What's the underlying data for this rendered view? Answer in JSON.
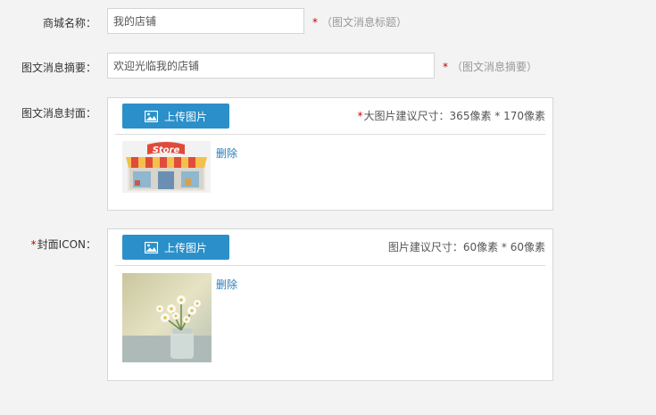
{
  "form": {
    "shop_name": {
      "label": "商城名称：",
      "value": "我的店铺",
      "hint": "（图文消息标题）"
    },
    "summary": {
      "label": "图文消息摘要：",
      "value": "欢迎光临我的店铺",
      "hint": "（图文消息摘要）"
    },
    "cover": {
      "label": "图文消息封面：",
      "upload_label": "上传图片",
      "size_hint": "大图片建议尺寸：365像素 * 170像素",
      "delete_label": "删除",
      "image_text": "Store"
    },
    "icon": {
      "label": "封面ICON：",
      "upload_label": "上传图片",
      "size_hint": "图片建议尺寸：60像素 * 60像素",
      "delete_label": "删除"
    },
    "required_mark": "*"
  },
  "colors": {
    "accent": "#2b90c9",
    "required": "#cc0000",
    "link": "#2b7dbb"
  }
}
